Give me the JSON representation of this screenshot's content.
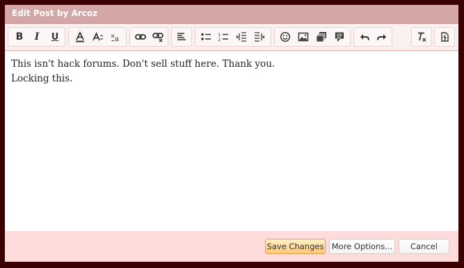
{
  "dialog": {
    "title": "Edit Post by Arcoz"
  },
  "toolbar": {
    "bold_label": "B",
    "italic_label": "I",
    "underline_label": "U",
    "icons": [
      "bold-icon",
      "italic-icon",
      "underline-icon",
      "font-color-icon",
      "font-size-icon",
      "font-family-icon",
      "link-icon",
      "unlink-icon",
      "align-icon",
      "bullet-list-icon",
      "numbered-list-icon",
      "outdent-icon",
      "indent-icon",
      "smilie-icon",
      "image-icon",
      "media-icon",
      "quote-icon",
      "undo-icon",
      "redo-icon",
      "remove-format-icon",
      "toggle-bbcode-icon"
    ]
  },
  "editor": {
    "line1": "This isn't hack forums. Don't sell stuff here. Thank you.",
    "line2": "Locking this."
  },
  "footer": {
    "save_label": "Save Changes",
    "more_label": "More Options...",
    "cancel_label": "Cancel"
  },
  "colors": {
    "backdrop": "#3a0000",
    "titlebar": "#d4a6a6",
    "panel": "#ffdcdc",
    "save_button": "#ffc878"
  }
}
